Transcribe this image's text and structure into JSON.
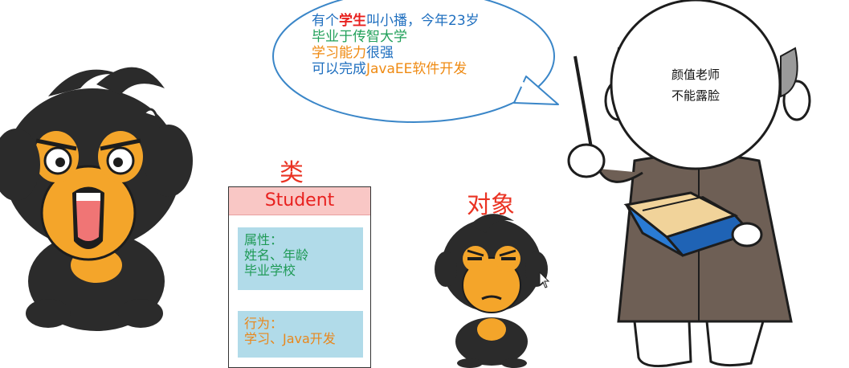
{
  "speech_bubble": {
    "line1": {
      "pre": "有个",
      "highlight": "学生",
      "post": "叫小播，今年23岁"
    },
    "line2": "毕业于传智大学",
    "line3": {
      "orange": "学习能力",
      "blue": "很强"
    },
    "line4": {
      "pre": "可以完成",
      "orange": "JavaEE软件开发"
    }
  },
  "labels": {
    "class": "类",
    "object": "对象"
  },
  "class_card": {
    "title": "Student",
    "attributes": [
      "属性：",
      "姓名、年龄",
      "毕业学校"
    ],
    "behaviors": [
      "行为：",
      "学习、Java开发"
    ]
  },
  "teacher_face": [
    "颜值老师",
    "不能露脸"
  ],
  "colors": {
    "blue": "#1f6fbf",
    "green": "#22a05a",
    "orange": "#ef8a12",
    "red": "#e8211f",
    "card_header": "#f9c7c5",
    "card_block": "#b1dbe9"
  }
}
